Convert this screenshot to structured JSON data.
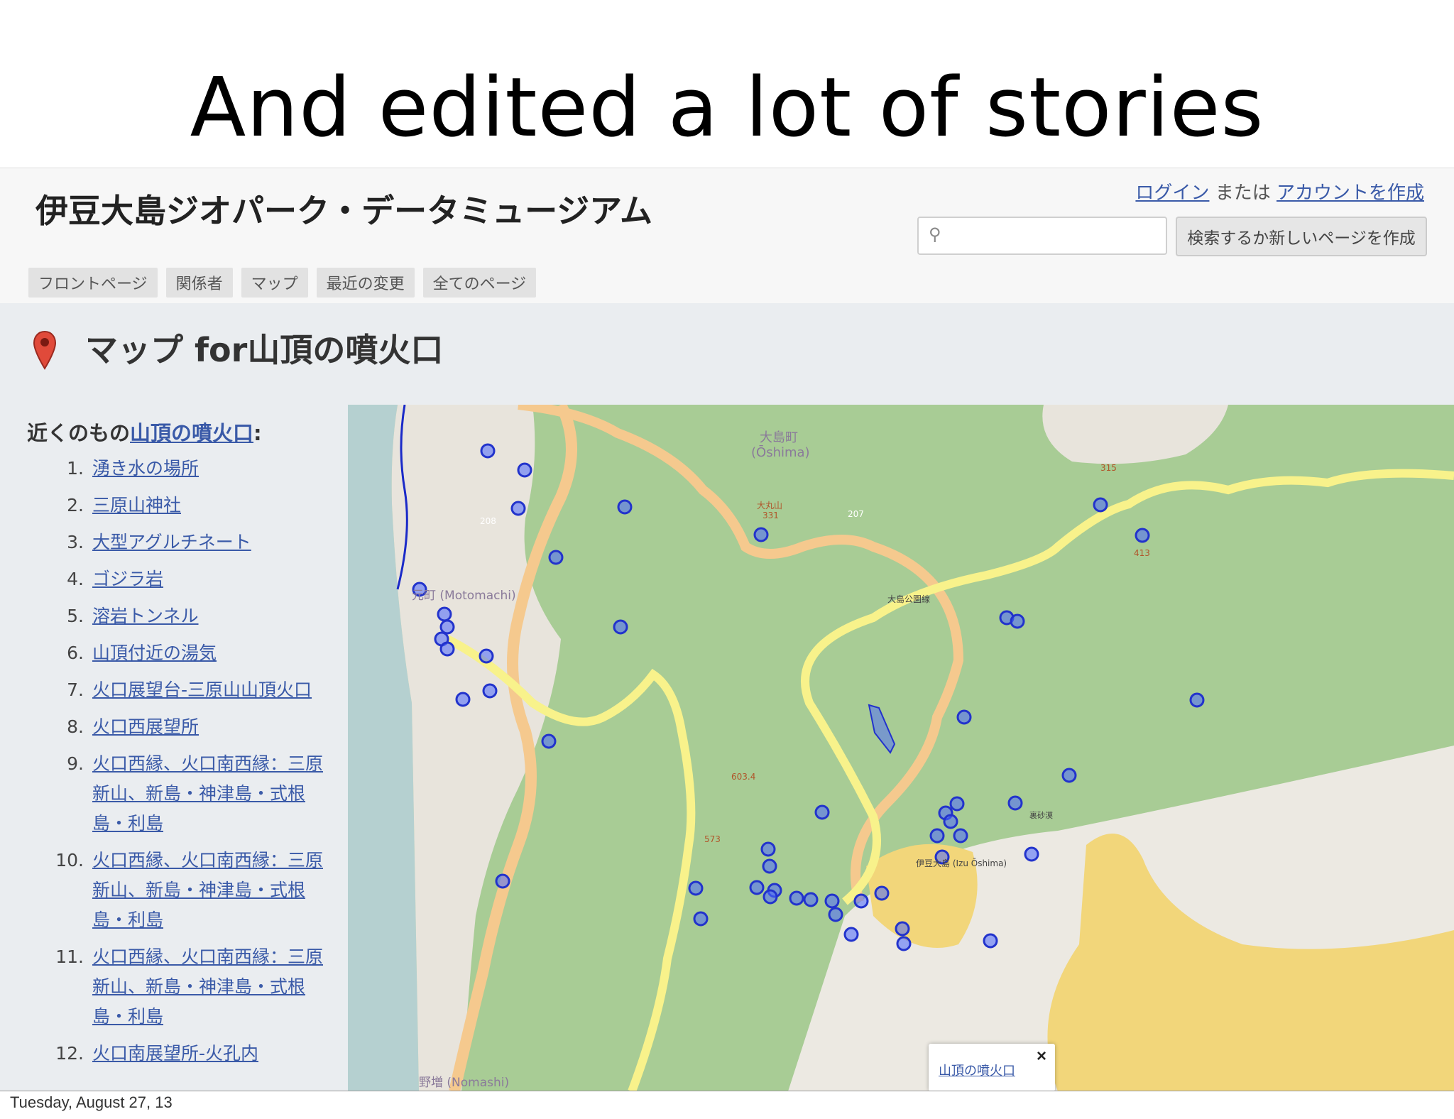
{
  "slide": {
    "title": "And edited a lot of stories",
    "footer_date": "Tuesday, August 27, 13"
  },
  "site": {
    "title": "伊豆大島ジオパーク・データミュージアム",
    "login_link": "ログイン",
    "or_text": "または",
    "create_account_link": "アカウントを作成",
    "search_placeholder": "",
    "search_button": "検索するか新しいページを作成",
    "nav": [
      "フロントページ",
      "関係者",
      "マップ",
      "最近の変更",
      "全てのページ"
    ]
  },
  "page": {
    "title": "マップ for山頂の噴火口",
    "near_prefix": "近くのもの",
    "near_target": "山頂の噴火口",
    "near_suffix": ":",
    "near_items": [
      {
        "num": "1.",
        "label": "湧き水の場所"
      },
      {
        "num": "2.",
        "label": "三原山神社"
      },
      {
        "num": "3.",
        "label": "大型アグルチネート"
      },
      {
        "num": "4.",
        "label": "ゴジラ岩"
      },
      {
        "num": "5.",
        "label": "溶岩トンネル"
      },
      {
        "num": "6.",
        "label": "山頂付近の湯気"
      },
      {
        "num": "7.",
        "label": "火口展望台-三原山山頂火口"
      },
      {
        "num": "8.",
        "label": "火口西展望所"
      },
      {
        "num": "9.",
        "label": "火口西縁、火口南西縁：三原新山、新島・神津島・式根島・利島"
      },
      {
        "num": "10.",
        "label": "火口西縁、火口南西縁：三原新山、新島・神津島・式根島・利島"
      },
      {
        "num": "11.",
        "label": "火口西縁、火口南西縁：三原新山、新島・神津島・式根島・利島"
      },
      {
        "num": "12.",
        "label": "火口南展望所-火孔内"
      }
    ]
  },
  "map": {
    "labels": {
      "oshima_town": "大島町",
      "oshima_romaji": "(Ōshima)",
      "motomachi": "元町 (Motomachi)",
      "nomashi": "野増 (Nomashi)",
      "izu_oshima": "伊豆大島 (Izu Ōshima)",
      "park_road": "大島公園線",
      "ura_sabaku": "裏砂漠",
      "route_208": "208",
      "route_207": "207",
      "peak_315": "315",
      "peak_413": "413",
      "peak_331": "331",
      "peak_ohmaru": "大丸山",
      "peak_6034": "603.4",
      "peak_573": "573"
    },
    "popup_link": "山頂の噴火口",
    "popup_close": "×",
    "colors": {
      "land": "#a8cc95",
      "sea": "#b5d0d0",
      "town": "#e8e4dc",
      "lava": "#f2d67a",
      "road_major": "#f5c98e",
      "road_yellow": "#f8f28b",
      "marker": "#4a68ff"
    }
  }
}
